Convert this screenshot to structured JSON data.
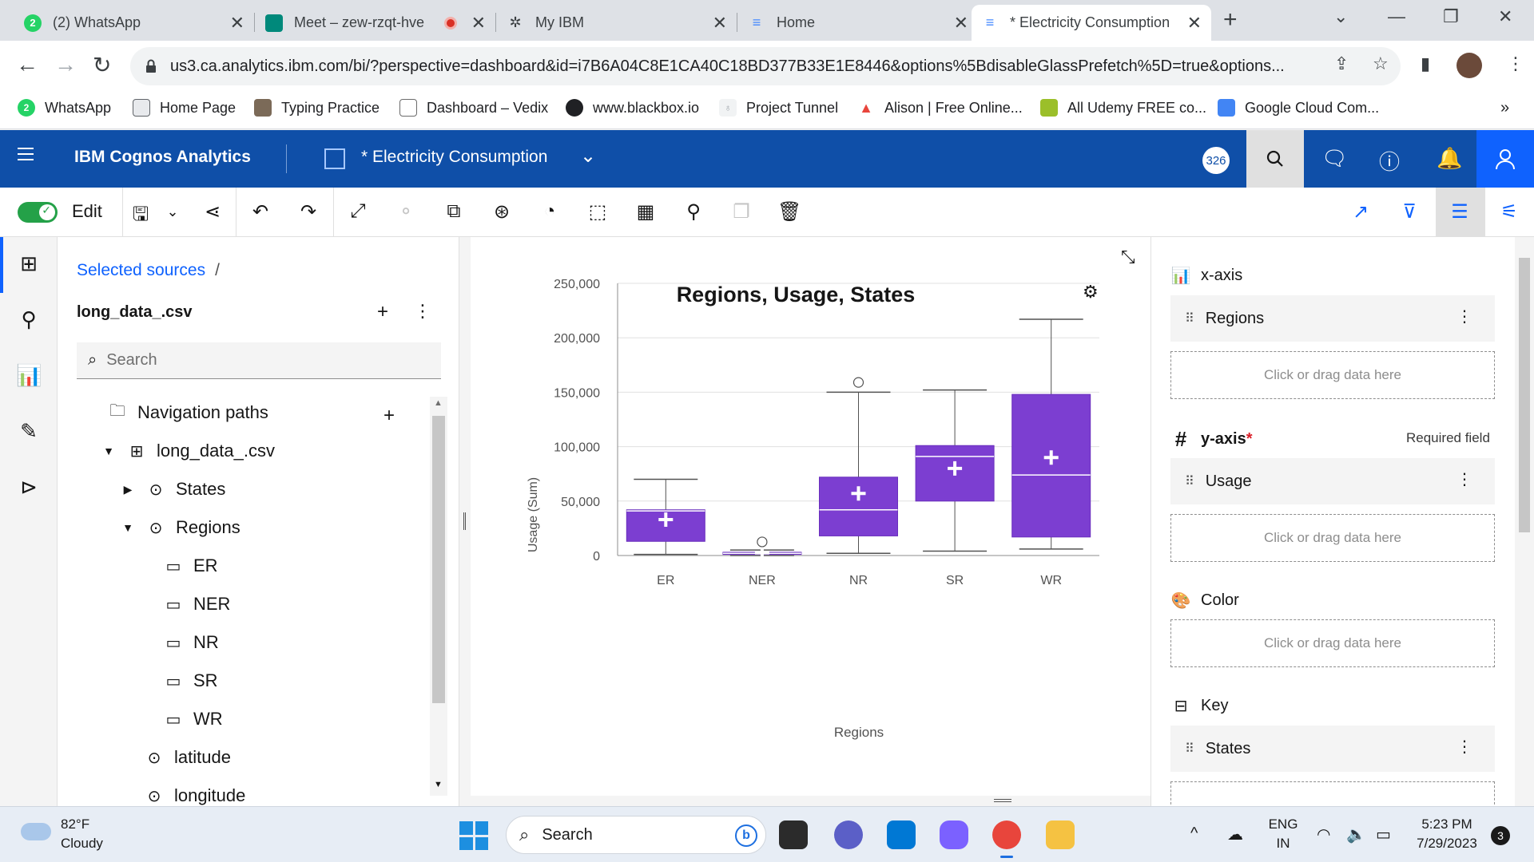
{
  "browser": {
    "tabs": [
      {
        "title": "(2) WhatsApp",
        "icon": "whatsapp-icon",
        "badge": "2"
      },
      {
        "title": "Meet – zew-rzqt-hve",
        "icon": "google-meet-icon"
      },
      {
        "title": "My IBM",
        "icon": "ibm-bee-icon"
      },
      {
        "title": "Home",
        "icon": "cognos-icon"
      },
      {
        "title": "* Electricity Consumption",
        "icon": "cognos-icon",
        "active": true
      }
    ],
    "url": "us3.ca.analytics.ibm.com/bi/?perspective=dashboard&id=i7B6A04C8E1CA40C18BD377B33E1E8446&options%5BdisableGlassPrefetch%5D=true&options...",
    "bookmarks": [
      {
        "label": "WhatsApp",
        "color": "#25d366"
      },
      {
        "label": "Home Page",
        "color": "#5f6368"
      },
      {
        "label": "Typing Practice",
        "color": "#7b6a58"
      },
      {
        "label": "Dashboard – Vedix",
        "color": "#6b6b6b"
      },
      {
        "label": "www.blackbox.io",
        "color": "#202124"
      },
      {
        "label": "Project Tunnel",
        "color": "#9aa0a6"
      },
      {
        "label": "Alison | Free Online...",
        "color": "#e8453c"
      },
      {
        "label": "All Udemy FREE co...",
        "color": "#9bbf2a"
      },
      {
        "label": "Google Cloud Com...",
        "color": "#4285f4"
      }
    ]
  },
  "app": {
    "brand": "IBM Cognos Analytics",
    "dashboard_title": "* Electricity Consumption",
    "badge": "326",
    "edit_label": "Edit",
    "accent": "#0f4fa8"
  },
  "sources": {
    "breadcrumb": "Selected sources",
    "breadcrumb_sep": "/",
    "source_name": "long_data_.csv",
    "search_placeholder": "Search",
    "tree": [
      {
        "label": "Navigation paths",
        "icon": "folder-icon"
      },
      {
        "label": "long_data_.csv",
        "icon": "table-icon"
      },
      {
        "label": "States",
        "icon": "location-icon"
      },
      {
        "label": "Regions",
        "icon": "location-icon"
      },
      {
        "label": "ER",
        "icon": "member-icon"
      },
      {
        "label": "NER",
        "icon": "member-icon"
      },
      {
        "label": "NR",
        "icon": "member-icon"
      },
      {
        "label": "SR",
        "icon": "member-icon"
      },
      {
        "label": "WR",
        "icon": "member-icon"
      },
      {
        "label": "latitude",
        "icon": "location-icon"
      },
      {
        "label": "longitude",
        "icon": "location-icon"
      }
    ]
  },
  "chart_data": {
    "type": "boxplot",
    "title": "Regions, Usage, States",
    "xlabel": "Regions",
    "ylabel": "Usage (Sum)",
    "ylim": [
      0,
      250000
    ],
    "yticks": [
      "0",
      "50,000",
      "100,000",
      "150,000",
      "200,000",
      "250,000"
    ],
    "ytick_values": [
      0,
      50000,
      100000,
      150000,
      200000,
      250000
    ],
    "color": "#7c3ed1",
    "categories": [
      "ER",
      "NER",
      "NR",
      "SR",
      "WR"
    ],
    "boxes": [
      {
        "min": 1000,
        "q1": 13000,
        "median": 41000,
        "mean": 33000,
        "q3": 42000,
        "max": 70000,
        "outliers": []
      },
      {
        "min": 0,
        "q1": 1000,
        "median": 2000,
        "mean": 2500,
        "q3": 3000,
        "max": 5000,
        "outliers": [
          12500
        ]
      },
      {
        "min": 2000,
        "q1": 18000,
        "median": 42000,
        "mean": 57000,
        "q3": 72000,
        "max": 150000,
        "outliers": [
          159000
        ]
      },
      {
        "min": 4000,
        "q1": 50000,
        "median": 91000,
        "mean": 80000,
        "q3": 101000,
        "max": 152000,
        "outliers": []
      },
      {
        "min": 6000,
        "q1": 17000,
        "median": 74000,
        "mean": 90000,
        "q3": 148000,
        "max": 217000,
        "outliers": []
      }
    ]
  },
  "props": {
    "xaxis_label": "x-axis",
    "xaxis_item": "Regions",
    "yaxis_label": "y-axis",
    "yaxis_required_mark": "*",
    "required_text": "Required field",
    "yaxis_item": "Usage",
    "color_label": "Color",
    "key_label": "Key",
    "key_item": "States",
    "dropzone_text": "Click or drag data here"
  },
  "taskbar": {
    "temperature": "82°F",
    "condition": "Cloudy",
    "search_placeholder": "Search",
    "lang_top": "ENG",
    "lang_bottom": "IN",
    "time": "5:23 PM",
    "date": "7/29/2023",
    "notifications": "3"
  }
}
